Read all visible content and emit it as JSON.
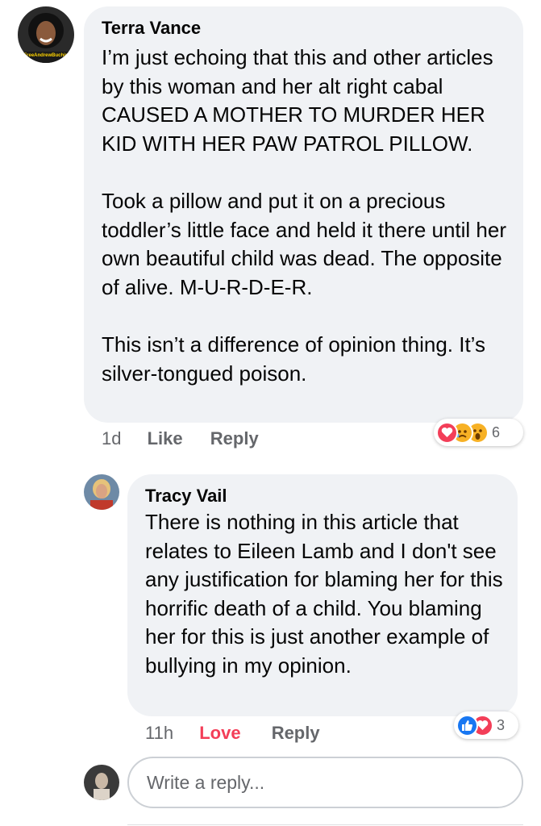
{
  "comments": [
    {
      "author": "Terra Vance",
      "avatar_badge": "#FreeAndrewBuchina",
      "text": "I’m just echoing that this and other articles by this woman and her alt right cabal CAUSED A MOTHER TO MURDER HER KID WITH HER PAW PATROL PILLOW.\n\nTook a pillow and put it on a precious toddler’s little face and held it there until her own beautiful child was dead. The opposite of alive. M-U-R-D-E-R.\n\nThis isn’t a difference of opinion thing. It’s silver-tongued poison.",
      "time": "1d",
      "like_label": "Like",
      "reply_label": "Reply",
      "reactions": [
        "love-icon",
        "sad-icon",
        "wow-icon"
      ],
      "reaction_count": "6"
    },
    {
      "author": "Tracy Vail",
      "text": "There is nothing in this article that relates to Eileen Lamb and I don't see any justification for blaming her for this horrific death of a child. You blaming her for this is just another example of bullying in my opinion.",
      "time": "11h",
      "love_label": "Love",
      "reply_label": "Reply",
      "reactions": [
        "like-icon",
        "love-icon"
      ],
      "reaction_count": "3"
    }
  ],
  "reply_box": {
    "placeholder": "Write a reply..."
  },
  "colors": {
    "bubble": "#f0f2f5",
    "action_text": "#65676b",
    "love_red": "#f33e58",
    "like_blue": "#1877f2",
    "reaction_yellow": "#f7b125"
  }
}
